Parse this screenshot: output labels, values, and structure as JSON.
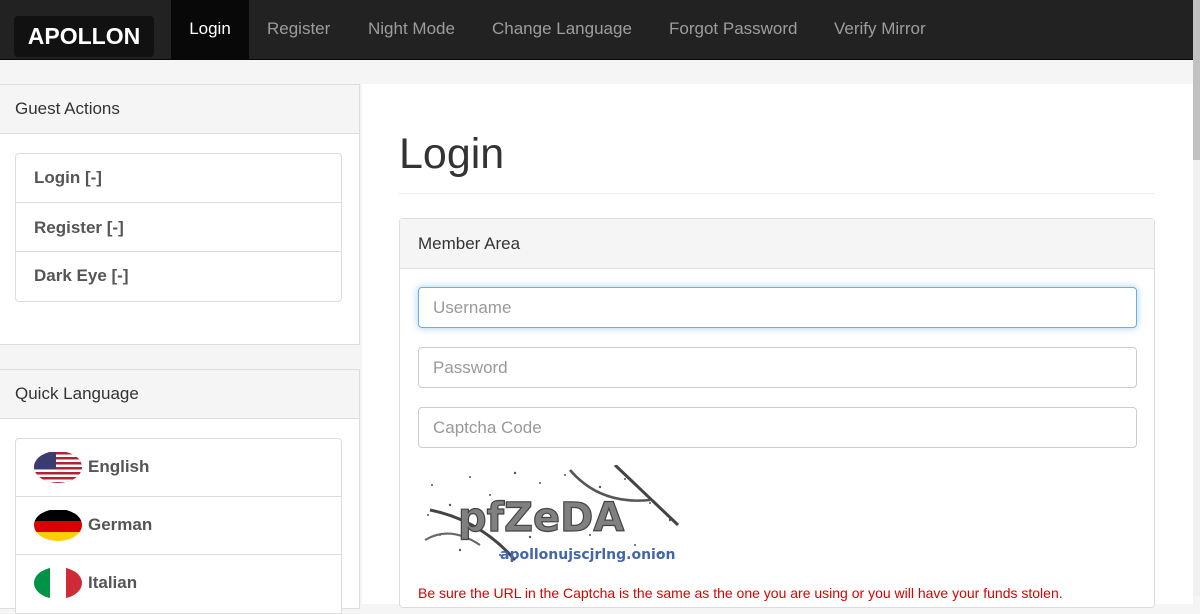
{
  "navbar": {
    "brand": "APOLLON",
    "items": [
      {
        "label": "Login",
        "active": true
      },
      {
        "label": "Register"
      },
      {
        "label": "Night Mode"
      },
      {
        "label": "Change Language"
      },
      {
        "label": "Forgot Password"
      },
      {
        "label": "Verify Mirror"
      }
    ]
  },
  "sidebar": {
    "guest": {
      "title": "Guest Actions",
      "items": [
        "Login [-]",
        "Register [-]",
        "Dark Eye [-]"
      ]
    },
    "language": {
      "title": "Quick Language",
      "items": [
        {
          "label": "English",
          "icon": "us-flag-icon"
        },
        {
          "label": "German",
          "icon": "germany-flag-icon"
        },
        {
          "label": "Italian",
          "icon": "italy-flag-icon"
        }
      ]
    }
  },
  "main": {
    "title": "Login",
    "panel_title": "Member Area",
    "username_placeholder": "Username",
    "password_placeholder": "Password",
    "captcha_placeholder": "Captcha Code",
    "captcha": {
      "text": "pfZeDA",
      "url": "apollonujscjrlng.onion"
    },
    "warning": "Be sure the URL in the Captcha is the same as the one you are using or you will have your funds stolen."
  },
  "colors": {
    "navbar": "#222222",
    "warning": "#dd0000",
    "focus": "#66afe9"
  }
}
